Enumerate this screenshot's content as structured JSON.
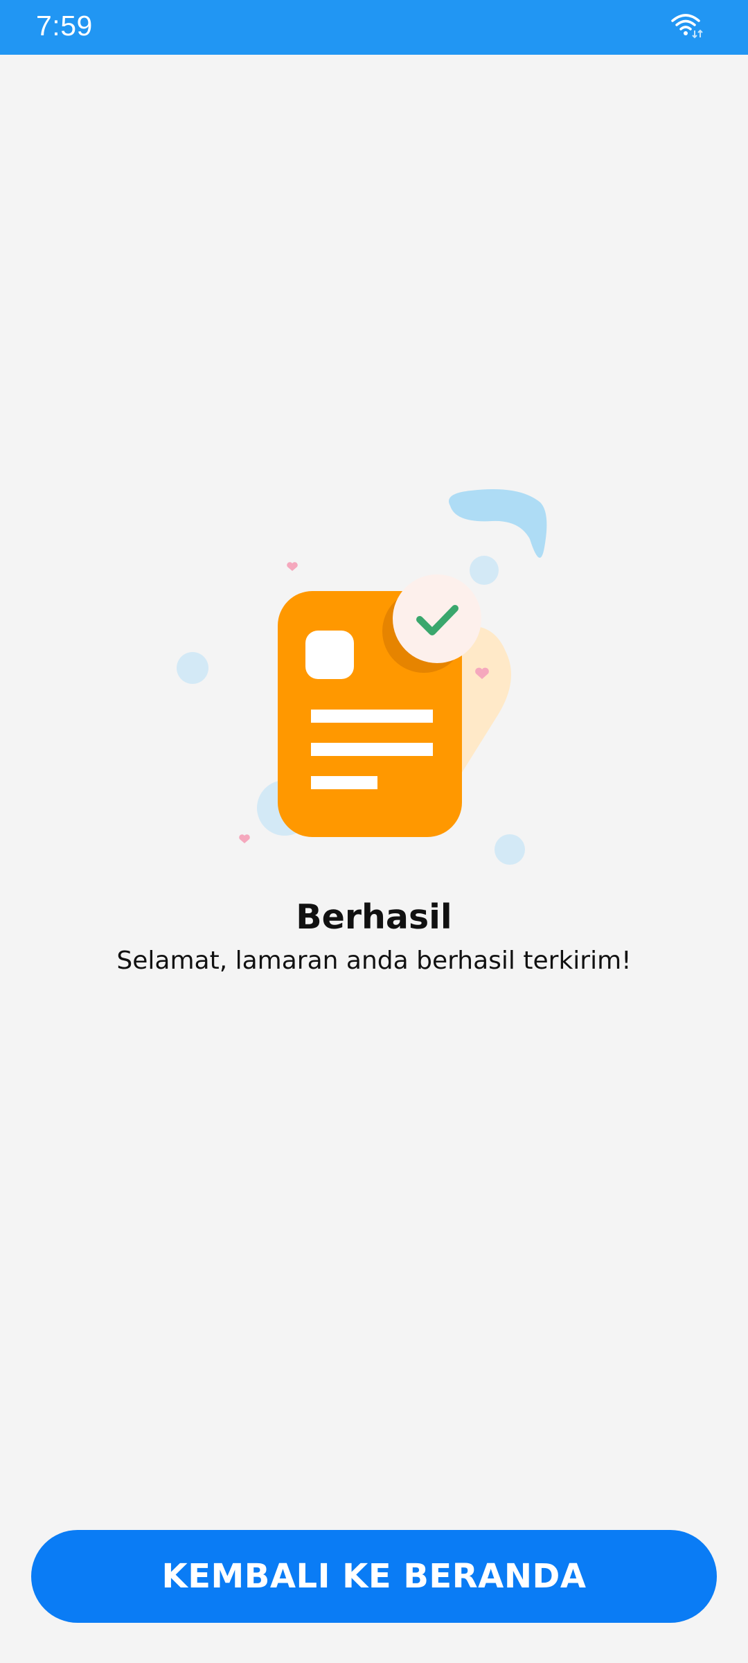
{
  "status_bar": {
    "time": "7:59",
    "wifi_icon": "wifi-icon",
    "background_color": "#2196f3"
  },
  "illustration": {
    "icon": "document-check-icon",
    "document_color": "#ff9800",
    "check_color": "#3aa76d"
  },
  "message": {
    "title": "Berhasil",
    "subtitle": "Selamat, lamaran anda berhasil terkirim!"
  },
  "actions": {
    "home_button_label": "KEMBALI KE BERANDA",
    "button_color": "#0a7cf5"
  }
}
